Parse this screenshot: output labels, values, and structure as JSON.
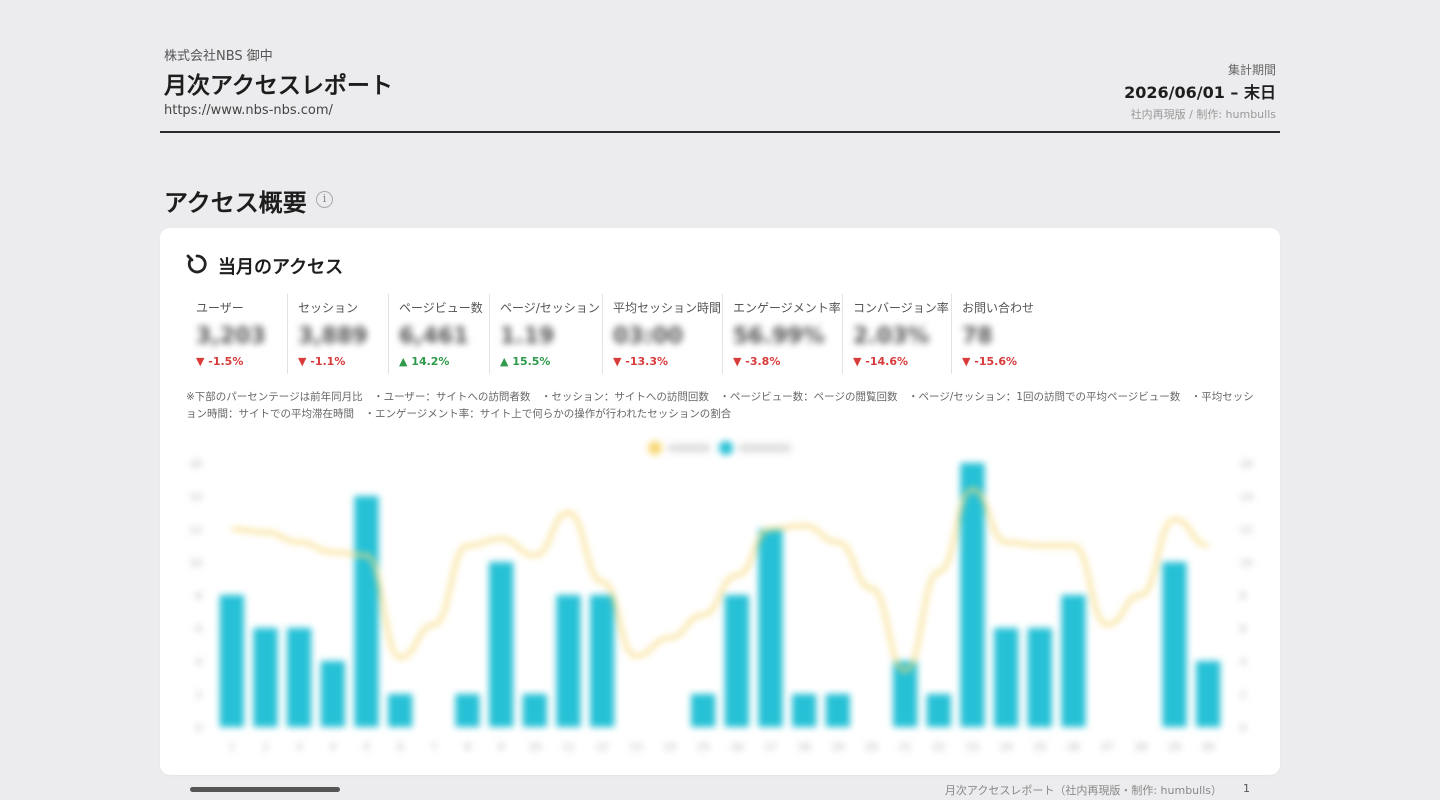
{
  "header": {
    "client": "株式会社NBS 御中",
    "title": "月次アクセスレポート",
    "url": "https://www.nbs-nbs.com/",
    "period_label": "集計期間",
    "period_value": "2026/06/01 – 末日",
    "credit": "社内再現版 / 制作: humbulls"
  },
  "section": {
    "title": "アクセス概要",
    "info_icon": "info-icon"
  },
  "card": {
    "title": "当月のアクセス",
    "icon": "refresh-icon",
    "kpis": [
      {
        "label": "ユーザー",
        "value": "3,203",
        "change": "▼ -1.5%",
        "direction": "down"
      },
      {
        "label": "セッション",
        "value": "3,889",
        "change": "▼ -1.1%",
        "direction": "down"
      },
      {
        "label": "ページビュー数",
        "value": "6,461",
        "change": "▲ 14.2%",
        "direction": "up"
      },
      {
        "label": "ページ/セッション",
        "value": "1.19",
        "change": "▲ 15.5%",
        "direction": "up"
      },
      {
        "label": "平均セッション時間",
        "value": "03:00",
        "change": "▼ -13.3%",
        "direction": "down"
      },
      {
        "label": "エンゲージメント率",
        "value": "56.99%",
        "change": "▼ -3.8%",
        "direction": "down"
      },
      {
        "label": "コンバージョン率",
        "value": "2.03%",
        "change": "▼ -14.6%",
        "direction": "down"
      },
      {
        "label": "お問い合わせ",
        "value": "78",
        "change": "▼ -15.6%",
        "direction": "down"
      }
    ],
    "note": "※下部のパーセンテージは前年同月比　・ユーザー：サイトへの訪問者数　・セッション：サイトへの訪問回数　・ページビュー数：ページの閲覧回数　・ページ/セッション：1回の訪問での平均ページビュー数　・平均セッション時間：サイトでの平均滞在時間　・エンゲージメント率：サイト上で何らかの操作が行われたセッションの割合"
  },
  "colors": {
    "bar": "#26c1d6",
    "line": "#f7d774",
    "down": "#d93a3a",
    "up": "#2e9a4a"
  },
  "chart_data": {
    "type": "bar",
    "categories": [
      "1",
      "2",
      "3",
      "4",
      "5",
      "6",
      "7",
      "8",
      "9",
      "10",
      "11",
      "12",
      "13",
      "14",
      "15",
      "16",
      "17",
      "18",
      "19",
      "20",
      "21",
      "22",
      "23",
      "24",
      "25",
      "26",
      "27",
      "28",
      "29",
      "30"
    ],
    "series": [
      {
        "type": "bar",
        "values": [
          8,
          6,
          6,
          4,
          14,
          2,
          0,
          2,
          10,
          2,
          8,
          8,
          0,
          0,
          2,
          8,
          12,
          2,
          2,
          0,
          4,
          2,
          16,
          6,
          6,
          8,
          0,
          0,
          10,
          4
        ]
      },
      {
        "type": "line",
        "values": [
          12,
          11.8,
          11.2,
          10.6,
          10.4,
          4.2,
          6.2,
          11,
          11.4,
          10.4,
          13,
          8.8,
          4.3,
          5.4,
          6.8,
          9.2,
          12,
          12.2,
          11.2,
          8.4,
          3.4,
          9.4,
          14.4,
          11.2,
          11,
          11,
          6.2,
          8,
          12.6,
          11
        ]
      }
    ],
    "ylim": [
      0,
      16
    ],
    "y2lim": [
      0,
      16
    ],
    "y_ticks": [
      "0",
      "2",
      "4",
      "6",
      "8",
      "10",
      "12",
      "14",
      "16"
    ],
    "legend": "top-center",
    "grid": false
  },
  "footer": {
    "text": "月次アクセスレポート（社内再現版・制作: humbulls）",
    "page": "1"
  }
}
